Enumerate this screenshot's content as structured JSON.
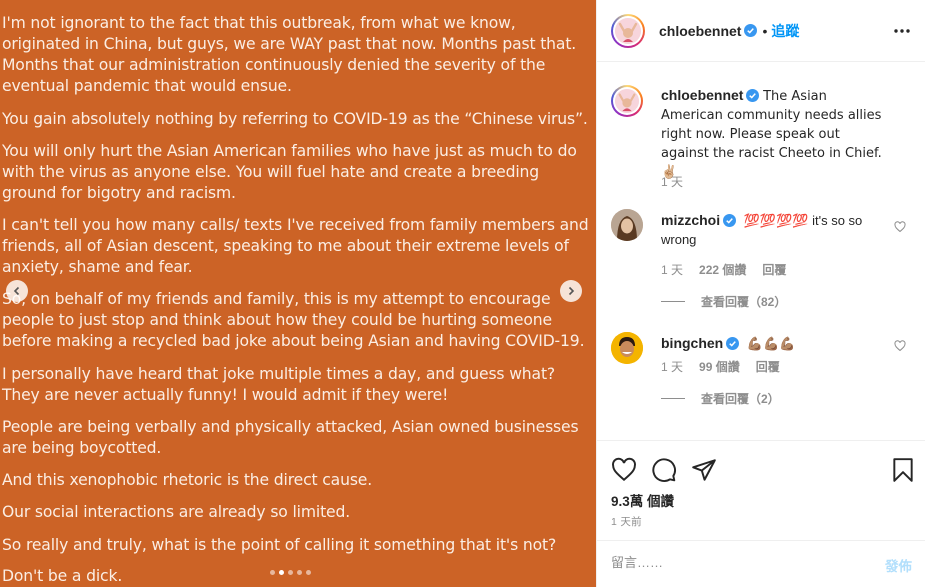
{
  "image_post": {
    "paragraphs": [
      "I'm not ignorant to the fact that this outbreak, from what we know, originated in China, but guys, we are WAY past that now. Months past that. Months that our administration continuously denied the severity of the eventual pandemic that would ensue.",
      "You gain absolutely nothing by referring to COVID-19 as the “Chinese virus”.",
      "You will only hurt the Asian American families who have just as much to do with the virus as anyone else. You will fuel hate and create a breeding ground for bigotry and racism.",
      "I can't tell you how many calls/ texts I've received from family members and friends, all of Asian descent, speaking to me about their extreme levels of anxiety, shame and fear.",
      "So, on behalf of my friends and family, this is my attempt to encourage people to just stop and think about how they could be hurting someone before making a recycled bad joke about being Asian and having COVID-19.",
      "I personally have heard that joke multiple times a day, and guess what? They are never actually funny! I would admit if they were!",
      "People are being verbally and physically attacked, Asian owned businesses are being boycotted.",
      "And this xenophobic rhetoric is the direct cause.",
      "Our social interactions are already so limited.",
      "So really and truly, what is the point of calling it something that it's not?",
      "Don't be a dick."
    ],
    "background_color": "#cc6326",
    "carousel_dots": 5,
    "active_dot": 1
  },
  "header": {
    "username": "chloebennet",
    "separator": "•",
    "follow_label": "追蹤",
    "more_icon": "more-horizontal-icon"
  },
  "caption": {
    "username": "chloebennet",
    "text": "The Asian American community needs allies right now. Please speak out against the racist Cheeto in Chief. ✌🏼",
    "time": "1 天"
  },
  "comments": [
    {
      "username": "mizzchoi",
      "emoji": "💯💯💯💯",
      "text": " it's so so wrong",
      "time": "1 天",
      "likes": "222 個讚",
      "reply_label": "回覆",
      "view_replies": "查看回覆（82）"
    },
    {
      "username": "bingchen",
      "emoji": "💪🏽💪🏽💪🏽",
      "text": "",
      "time": "1 天",
      "likes": "99 個讚",
      "reply_label": "回覆",
      "view_replies": "查看回覆（2）"
    }
  ],
  "actions": {
    "likes": "9.3萬 個讚",
    "date": "1 天前",
    "icons": [
      "heart-icon",
      "comment-icon",
      "share-icon",
      "bookmark-icon"
    ]
  },
  "add_comment": {
    "placeholder": "留言……",
    "post_label": "發佈"
  },
  "colors": {
    "link_blue": "#0095f6",
    "muted": "#8e8e8e",
    "post_disabled": "#b2dffc",
    "verified": "#3897f0"
  }
}
